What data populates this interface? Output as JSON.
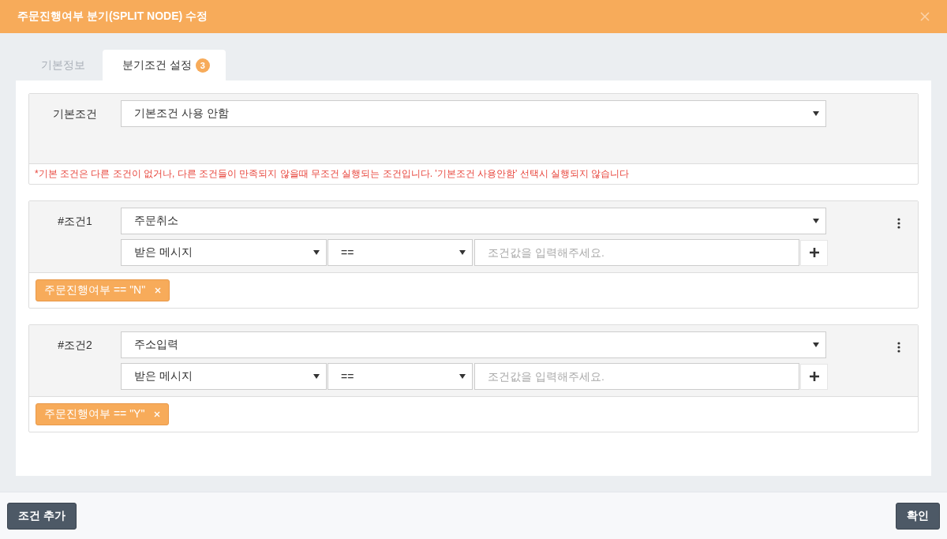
{
  "dialog": {
    "title": "주문진행여부 분기(SPLIT NODE) 수정"
  },
  "tabs": [
    {
      "label": "기본정보",
      "selected": false
    },
    {
      "label": "분기조건 설정",
      "selected": true,
      "badge": "3"
    }
  ],
  "default_condition": {
    "label": "기본조건",
    "value": "기본조건 사용 안함",
    "note": "*기본 조건은 다른 조건이 없거나, 다른 조건들이 만족되지 않을때 무조건 실행되는 조건입니다. '기본조건 사용안함' 선택시 실행되지 않습니다"
  },
  "conditions": [
    {
      "label": "#조건1",
      "event": "주문취소",
      "source": "받은 메시지",
      "operator": "==",
      "placeholder": "조건값을 입력해주세요.",
      "tags": [
        {
          "text": "주문진행여부 == \"N\""
        }
      ]
    },
    {
      "label": "#조건2",
      "event": "주소입력",
      "source": "받은 메시지",
      "operator": "==",
      "placeholder": "조건값을 입력해주세요.",
      "tags": [
        {
          "text": "주문진행여부 == \"Y\""
        }
      ]
    }
  ],
  "footer": {
    "buttons": [
      {
        "label": "조건 추가",
        "kind": "left"
      },
      {
        "label": "확인",
        "kind": "right"
      }
    ]
  }
}
